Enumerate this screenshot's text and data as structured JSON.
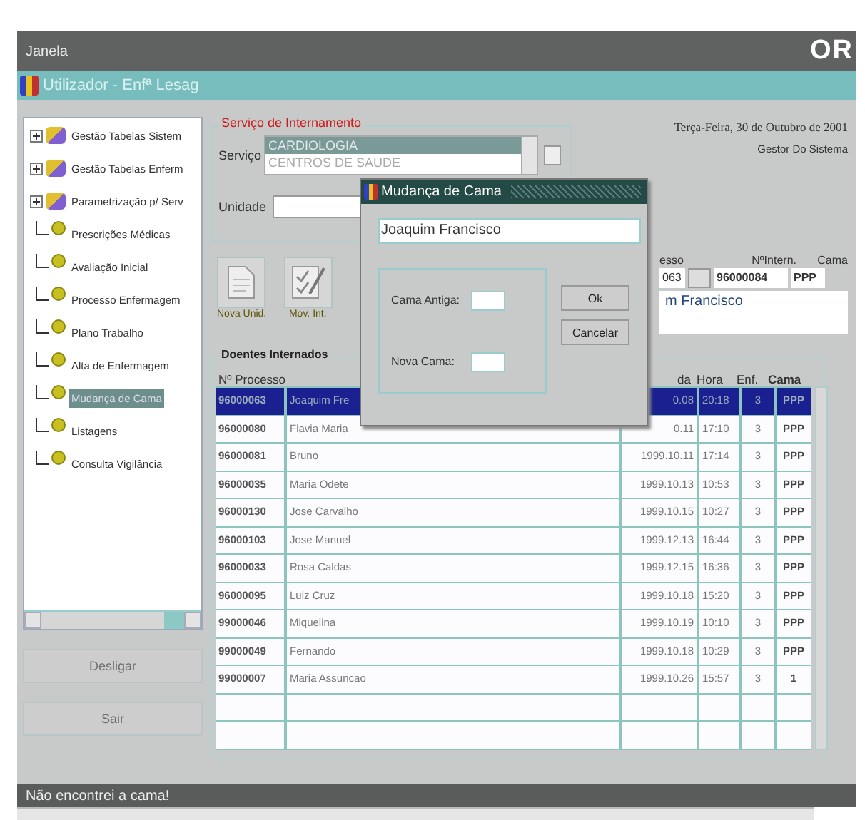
{
  "window": {
    "title": "Janela",
    "logo": "OR",
    "user_bar": "Utilizador - Enfª Lesag"
  },
  "tree": {
    "items": [
      {
        "kind": "folder",
        "label": "Gestão Tabelas Sistem",
        "expanded": false,
        "selected": false
      },
      {
        "kind": "folder",
        "label": "Gestão Tabelas Enferm",
        "expanded": false,
        "selected": false
      },
      {
        "kind": "folder",
        "label": "Parametrização p/ Serv",
        "expanded": false,
        "selected": false
      },
      {
        "kind": "leaf",
        "label": "Prescrições Médicas",
        "selected": false
      },
      {
        "kind": "leaf",
        "label": "Avaliação Inicial",
        "selected": false
      },
      {
        "kind": "leaf",
        "label": "Processo Enfermagem",
        "selected": false
      },
      {
        "kind": "leaf",
        "label": "Plano Trabalho",
        "selected": false
      },
      {
        "kind": "leaf",
        "label": "Alta de Enfermagem",
        "selected": false
      },
      {
        "kind": "leaf",
        "label": "Mudança de Cama",
        "selected": true
      },
      {
        "kind": "leaf",
        "label": "Listagens",
        "selected": false
      },
      {
        "kind": "leaf",
        "label": "Consulta Vigilância",
        "selected": false
      }
    ]
  },
  "left_buttons": [
    {
      "label": "Desligar",
      "disabled": true
    },
    {
      "label": "Sair",
      "disabled": true
    }
  ],
  "service_group": {
    "title": "Serviço de Internamento",
    "service_label": "Serviço",
    "options": [
      {
        "label": "CARDIOLOGIA",
        "selected": true
      },
      {
        "label": "CENTROS DE SAUDE",
        "selected": false
      }
    ],
    "unit_label": "Unidade"
  },
  "date": "Terça-Feira, 30 de Outubro de 2001",
  "role": "Gestor Do Sistema",
  "toolbar": [
    {
      "kind": "document",
      "label": "Nova Unid."
    },
    {
      "kind": "checklist",
      "label": "Mov. Int."
    }
  ],
  "patient_info": {
    "headers": [
      "esso",
      "NºIntern.",
      "Cama"
    ],
    "process": "063",
    "intern": "96000084",
    "bed": "PPP",
    "name": "m Francisco"
  },
  "table": {
    "title": "Doentes Internados",
    "columns": [
      "Nº Processo",
      "",
      "da",
      "Hora",
      "Enf.",
      "Cama"
    ],
    "rows": [
      {
        "selected": true,
        "cells": [
          "96000063",
          "Joaquim Fre",
          "0.08",
          "20:18",
          "3",
          "PPP"
        ]
      },
      {
        "selected": false,
        "cells": [
          "96000080",
          "Flavia Maria",
          "0.11",
          "17:10",
          "3",
          "PPP"
        ]
      },
      {
        "selected": false,
        "cells": [
          "96000081",
          "Bruno",
          "1999.10.11",
          "17:14",
          "3",
          "PPP"
        ]
      },
      {
        "selected": false,
        "cells": [
          "96000035",
          "Maria Odete",
          "1999.10.13",
          "10:53",
          "3",
          "PPP"
        ]
      },
      {
        "selected": false,
        "cells": [
          "96000130",
          "Jose Carvalho",
          "1999.10.15",
          "10:27",
          "3",
          "PPP"
        ]
      },
      {
        "selected": false,
        "cells": [
          "96000103",
          "Jose Manuel",
          "1999.12.13",
          "16:44",
          "3",
          "PPP"
        ]
      },
      {
        "selected": false,
        "cells": [
          "96000033",
          "Rosa Caldas",
          "1999.12.15",
          "16:36",
          "3",
          "PPP"
        ]
      },
      {
        "selected": false,
        "cells": [
          "96000095",
          "Luiz Cruz",
          "1999.10.18",
          "15:20",
          "3",
          "PPP"
        ]
      },
      {
        "selected": false,
        "cells": [
          "99000046",
          "Miquelina",
          "1999.10.19",
          "10:10",
          "3",
          "PPP"
        ]
      },
      {
        "selected": false,
        "cells": [
          "99000049",
          "Fernando",
          "1999.10.18",
          "10:29",
          "3",
          "PPP"
        ]
      },
      {
        "selected": false,
        "cells": [
          "99000007",
          "Maria Assuncao",
          "1999.10.26",
          "15:57",
          "3",
          "1"
        ]
      },
      {
        "selected": false,
        "cells": [
          "",
          "",
          "",
          "",
          "",
          ""
        ]
      },
      {
        "selected": false,
        "cells": [
          "",
          "",
          "",
          "",
          "",
          ""
        ]
      }
    ]
  },
  "dialog": {
    "title": "Mudança de Cama",
    "name_value": "Joaquim Francisco",
    "old_bed_label": "Cama Antiga:",
    "new_bed_label": "Nova Cama:",
    "buttons": [
      "Ok",
      "Cancelar"
    ]
  },
  "status_bar": "Não encontrei a cama!"
}
